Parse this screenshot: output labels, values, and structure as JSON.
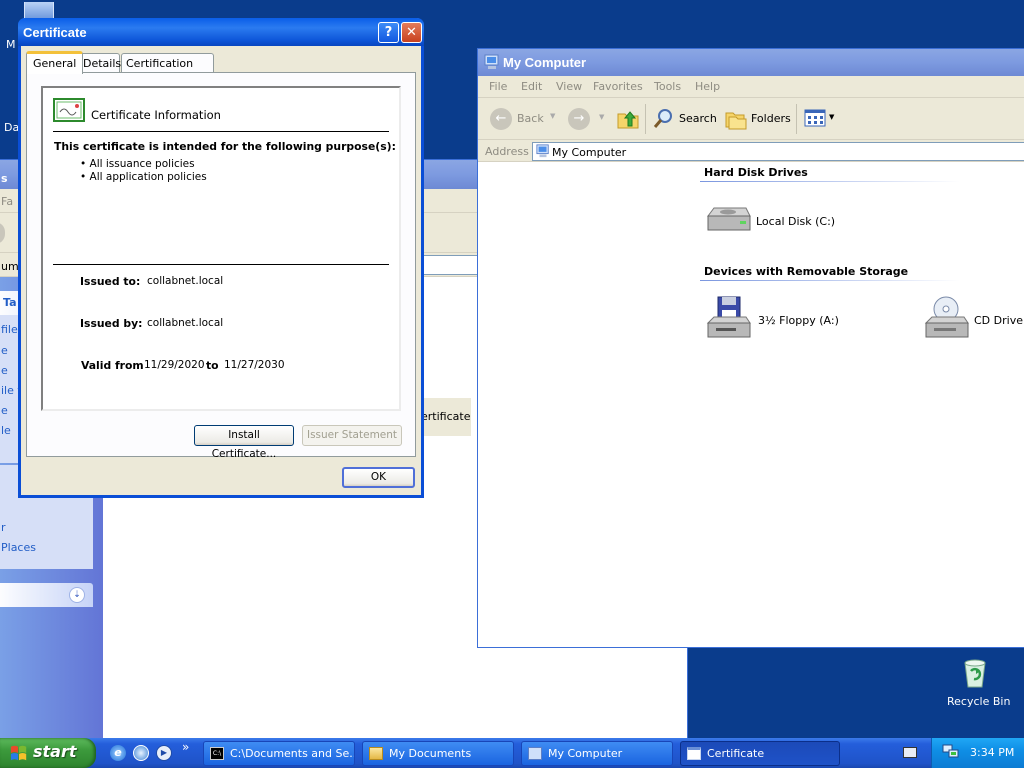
{
  "desktop": {
    "icons_left": [
      {
        "label": "M"
      },
      {
        "label": "Da"
      }
    ],
    "recycle_bin_label": "Recycle Bin"
  },
  "my_documents": {
    "side_labels": [
      "s",
      "Fa",
      "ume",
      "Ta",
      "file",
      "e",
      "e",
      "ile t",
      "e",
      "le",
      "r",
      "Places"
    ],
    "go_label": "Go",
    "background_file_label": "ertificate"
  },
  "my_computer": {
    "title": "My Computer",
    "menu": [
      "File",
      "Edit",
      "View",
      "Favorites",
      "Tools",
      "Help"
    ],
    "toolbar": {
      "back": "Back",
      "search": "Search",
      "folders": "Folders"
    },
    "address_label": "Address",
    "address_value": "My Computer",
    "sections": [
      {
        "heading": "Hard Disk Drives",
        "items": [
          {
            "label": "Local Disk (C:)"
          }
        ]
      },
      {
        "heading": "Devices with Removable Storage",
        "items": [
          {
            "label": "3½ Floppy (A:)"
          },
          {
            "label": "CD Drive ("
          }
        ]
      }
    ]
  },
  "certificate": {
    "title": "Certificate",
    "tabs": [
      "General",
      "Details",
      "Certification Path"
    ],
    "info_heading": "Certificate Information",
    "purpose_heading": "This certificate is intended for the following purpose(s):",
    "purposes": [
      "• All issuance policies",
      "• All application policies"
    ],
    "issued_to_label": "Issued to:",
    "issued_to_value": "collabnet.local",
    "issued_by_label": "Issued by:",
    "issued_by_value": "collabnet.local",
    "valid_from_label": "Valid from",
    "valid_from_value": "11/29/2020",
    "valid_to_label": "to",
    "valid_to_value": "11/27/2030",
    "install_button": "Install Certificate...",
    "issuer_statement_button": "Issuer Statement",
    "ok_button": "OK"
  },
  "taskbar": {
    "start_label": "start",
    "chevron": "»",
    "tasks": [
      {
        "label": "C:\\Documents and Se..."
      },
      {
        "label": "My Documents"
      },
      {
        "label": "My Computer"
      },
      {
        "label": "Certificate"
      }
    ],
    "clock": "3:34 PM"
  },
  "colors": {
    "accent": "#0a5ee8",
    "desktop": "#0a3c8c",
    "taskbar": "#245edb",
    "start": "#3c9a3c",
    "tray": "#0f8fe6"
  }
}
